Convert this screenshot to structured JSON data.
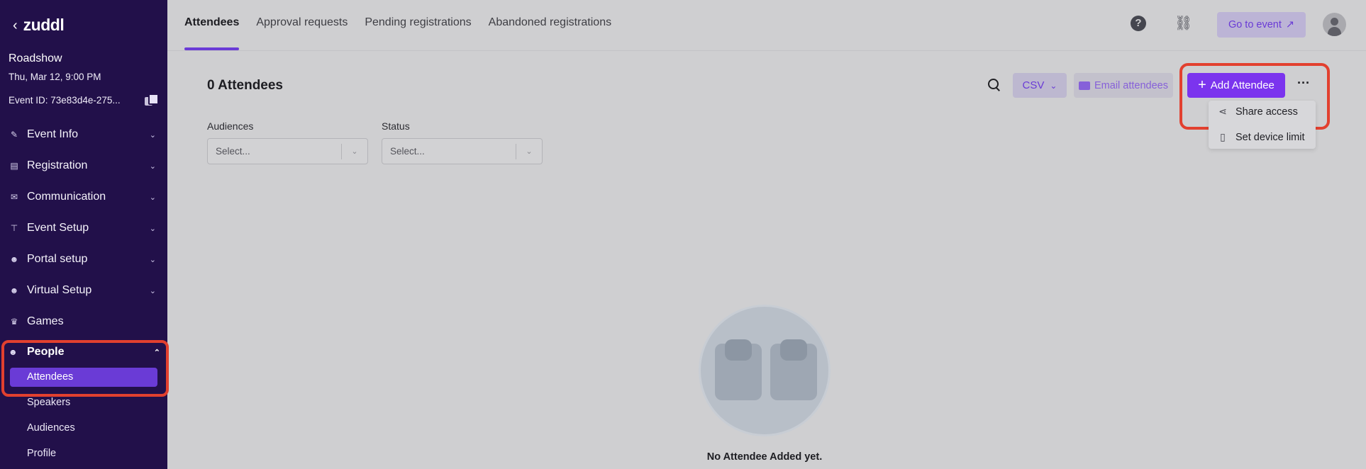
{
  "sidebar": {
    "logo": "zuddl",
    "back_icon": "chevron-left-icon",
    "event_name": "Roadshow",
    "event_date": "Thu, Mar 12, 9:00 PM",
    "event_id": "Event ID: 73e83d4e-275...",
    "nav": [
      {
        "label": "Event Info",
        "icon": "wand-icon"
      },
      {
        "label": "Registration",
        "icon": "form-icon"
      },
      {
        "label": "Communication",
        "icon": "mail-icon"
      },
      {
        "label": "Event Setup",
        "icon": "signpost-icon"
      },
      {
        "label": "Portal setup",
        "icon": "people-icon"
      },
      {
        "label": "Virtual Setup",
        "icon": "people-icon"
      },
      {
        "label": "Games",
        "icon": "crown-icon"
      }
    ],
    "people": {
      "label": "People",
      "active_child": "Attendees",
      "children": [
        "Speakers",
        "Audiences",
        "Profile"
      ]
    }
  },
  "topbar": {
    "tabs": [
      "Attendees",
      "Approval requests",
      "Pending registrations",
      "Abandoned registrations"
    ],
    "go_to_event": "Go to event"
  },
  "main": {
    "count_title": "0 Attendees",
    "csv_label": "CSV",
    "email_label": "Email attendees",
    "add_label": "Add Attendee",
    "more_label": "···",
    "menu": {
      "share": "Share access",
      "device": "Set device limit"
    },
    "filters": {
      "audiences_label": "Audiences",
      "audiences_placeholder": "Select...",
      "status_label": "Status",
      "status_placeholder": "Select..."
    },
    "empty_text": "No Attendee Added yet."
  },
  "colors": {
    "sidebar_bg": "#22104a",
    "accent": "#7b34ee",
    "highlight": "#e2402f"
  }
}
